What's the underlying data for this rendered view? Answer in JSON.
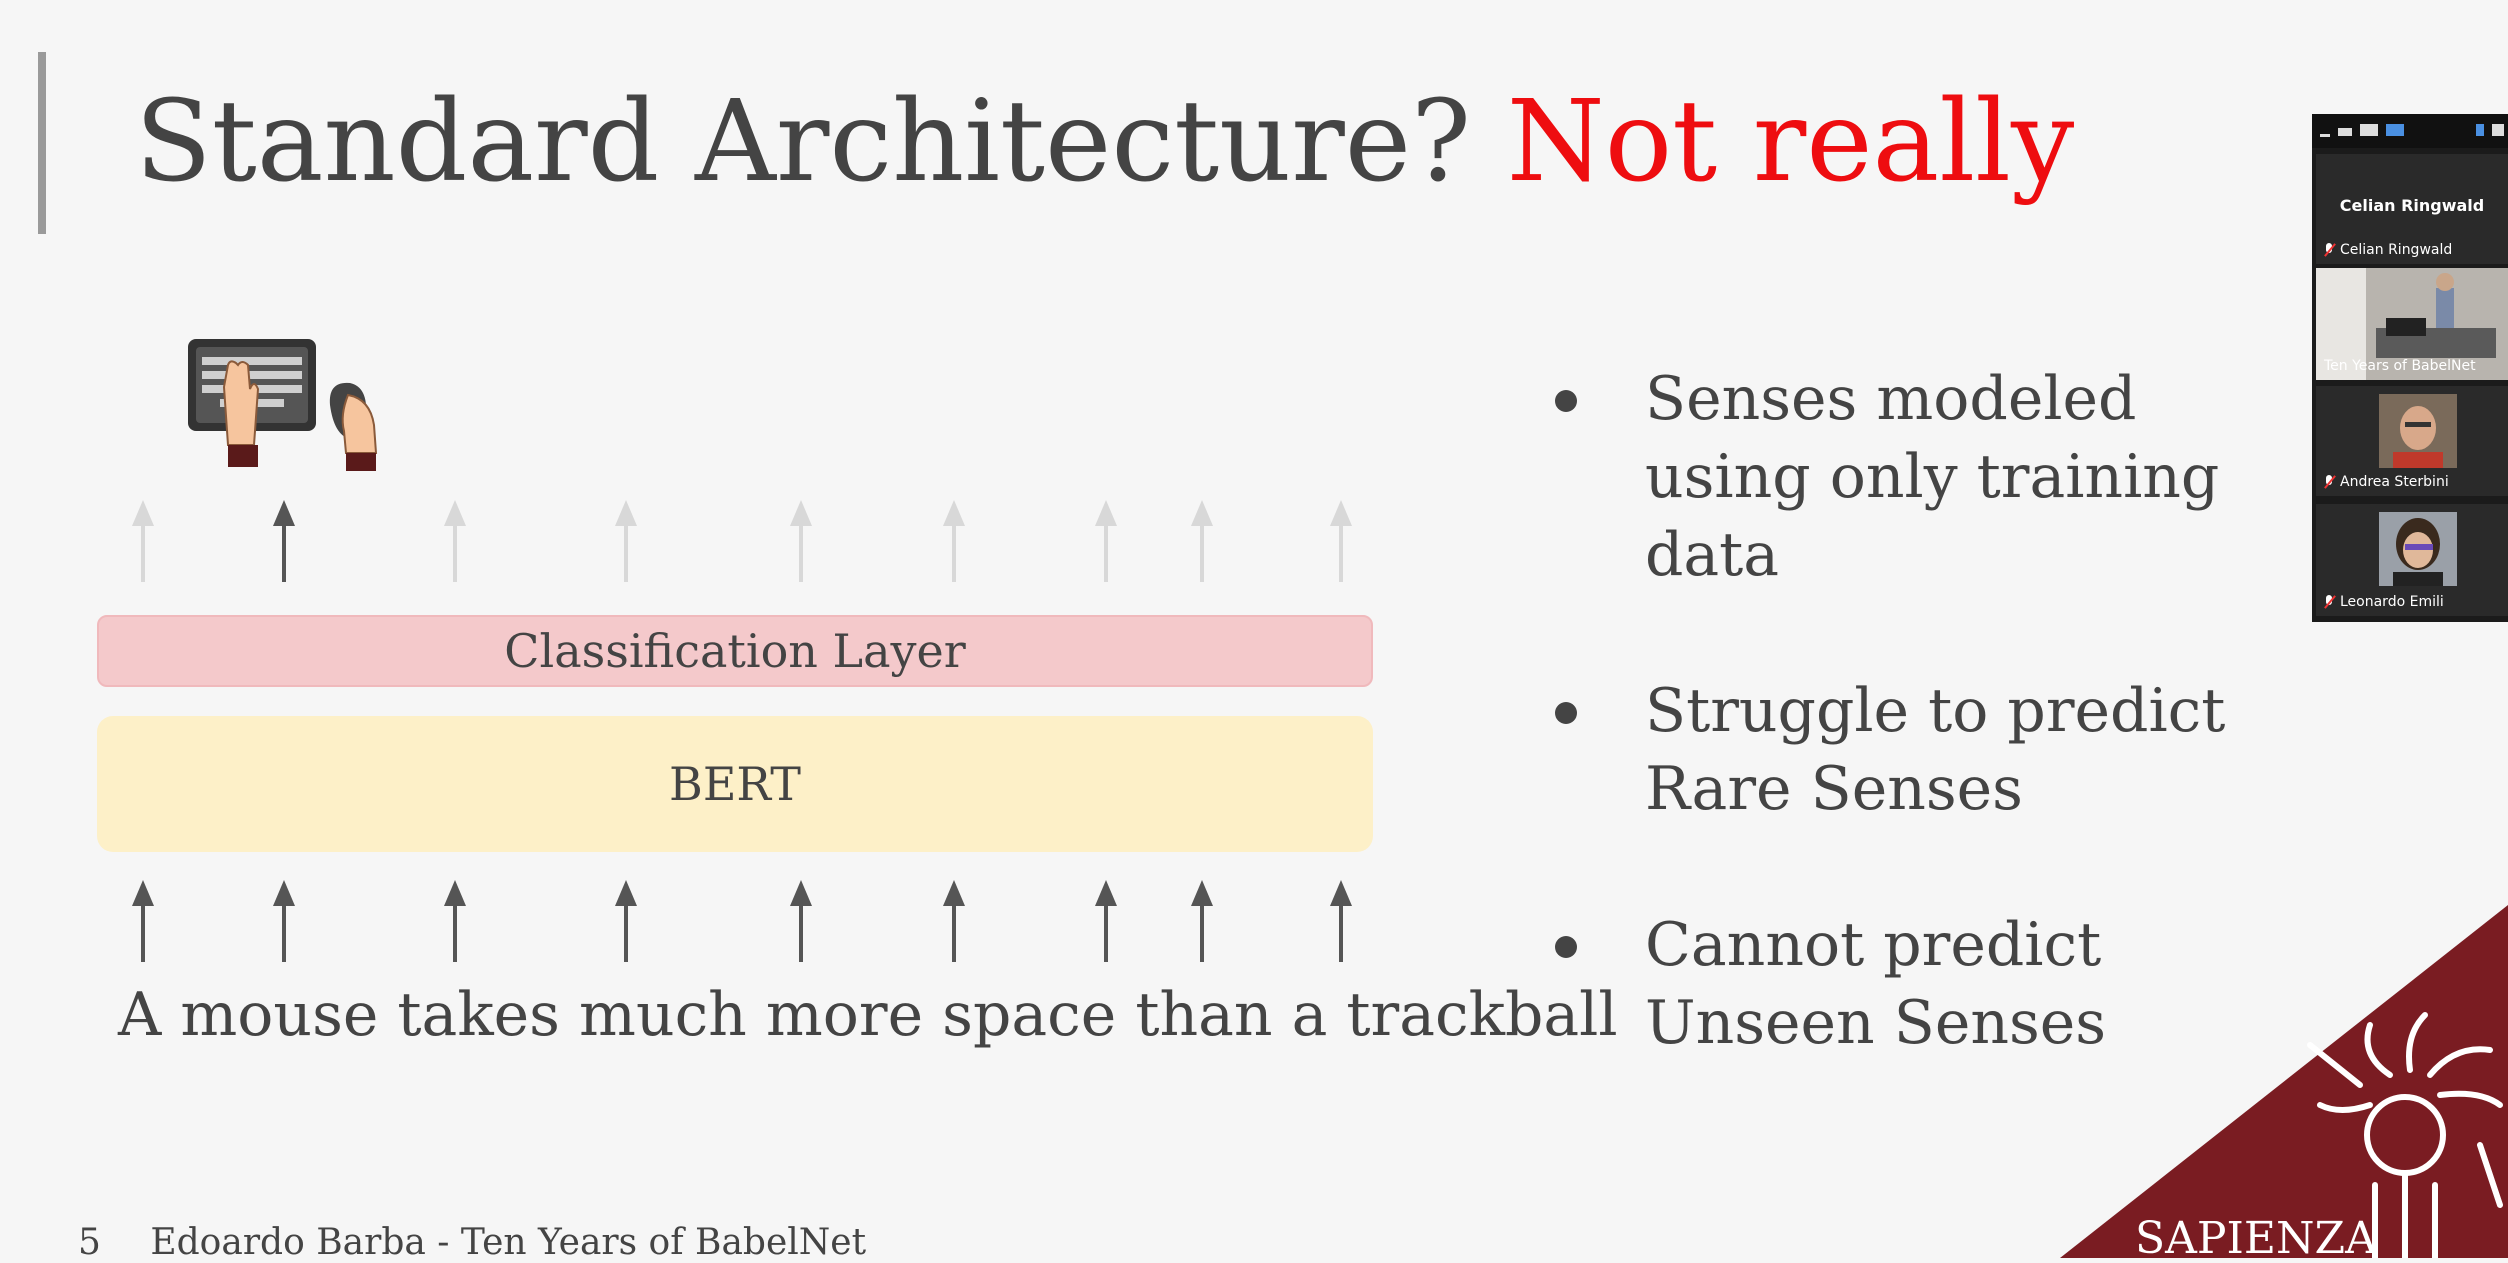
{
  "slide": {
    "title_main": "Standard Architecture?",
    "title_highlight": "Not really",
    "classification_label": "Classification Layer",
    "bert_label": "BERT",
    "sentence": "A mouse takes much more space than a trackball",
    "bullets": [
      "Senses modeled using only training data",
      "Struggle to predict Rare Senses",
      "Cannot predict Unseen Senses"
    ],
    "footer_page": "5",
    "footer_text": "Edoardo Barba - Ten Years of BabelNet",
    "logo_text": "SAPIENZA",
    "highlight_color": "#ee0d10"
  },
  "zoom_panel": {
    "speaker_heading": "Celian Ringwald",
    "participants": [
      {
        "name": "Celian Ringwald",
        "muted": true
      },
      {
        "name": "Ten Years of BabelNet",
        "muted": false,
        "active": true
      },
      {
        "name": "Andrea Sterbini",
        "muted": true
      },
      {
        "name": "Leonardo Emili",
        "muted": true
      }
    ],
    "active_border_color": "#3dcc5b"
  }
}
